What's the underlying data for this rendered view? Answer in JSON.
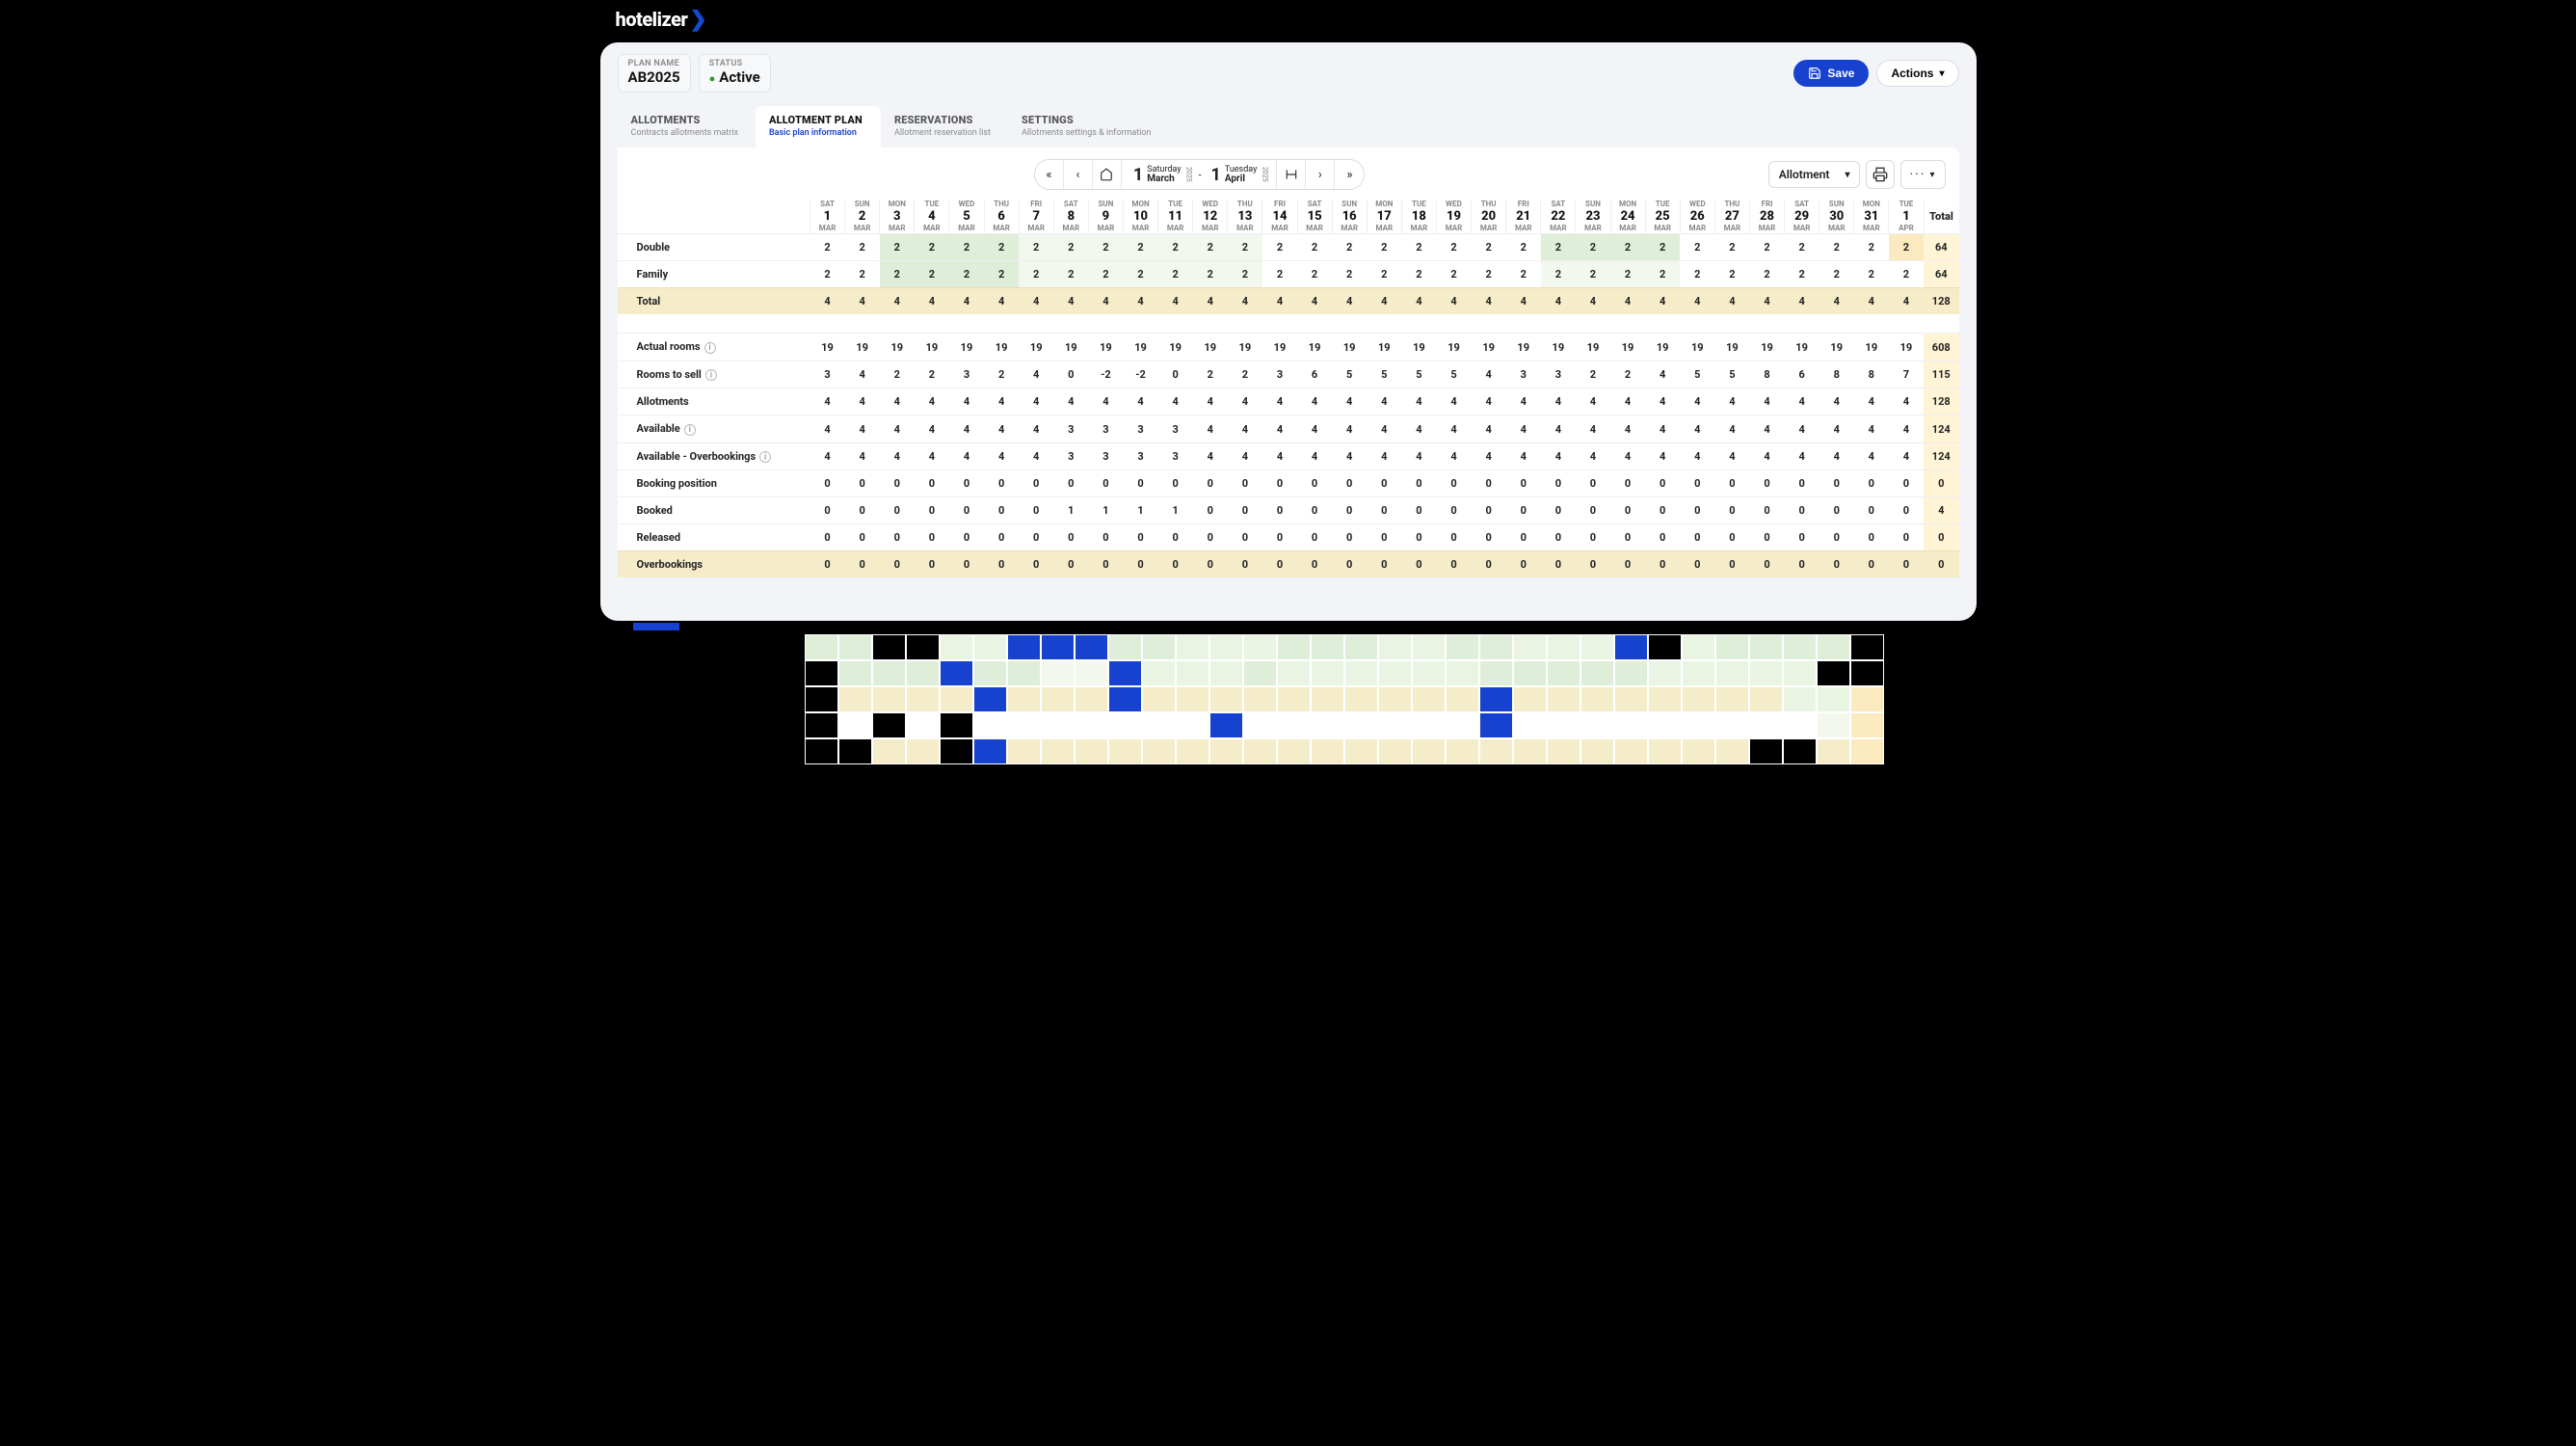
{
  "logo": {
    "text": "hotelizer"
  },
  "plan": {
    "name_label": "PLAN NAME",
    "name": "AB2025",
    "status_label": "STATUS",
    "status": "Active"
  },
  "actions": {
    "save": "Save",
    "more": "Actions"
  },
  "tabs": [
    {
      "title": "ALLOTMENTS",
      "sub": "Contracts allotments matrix"
    },
    {
      "title": "ALLOTMENT PLAN",
      "sub": "Basic plan information"
    },
    {
      "title": "RESERVATIONS",
      "sub": "Allotment reservation list"
    },
    {
      "title": "SETTINGS",
      "sub": "Allotments settings & information"
    }
  ],
  "daterange": {
    "from_day": "1",
    "from_dow": "Saturday",
    "from_month": "March",
    "from_year": "2025",
    "to_day": "1",
    "to_dow": "Tuesday",
    "to_month": "April",
    "to_year": "2025",
    "sep": "-"
  },
  "view_select": "Allotment",
  "columns": [
    {
      "dow": "SAT",
      "d": "1",
      "m": "MAR"
    },
    {
      "dow": "SUN",
      "d": "2",
      "m": "MAR"
    },
    {
      "dow": "MON",
      "d": "3",
      "m": "MAR"
    },
    {
      "dow": "TUE",
      "d": "4",
      "m": "MAR"
    },
    {
      "dow": "WED",
      "d": "5",
      "m": "MAR"
    },
    {
      "dow": "THU",
      "d": "6",
      "m": "MAR"
    },
    {
      "dow": "FRI",
      "d": "7",
      "m": "MAR"
    },
    {
      "dow": "SAT",
      "d": "8",
      "m": "MAR"
    },
    {
      "dow": "SUN",
      "d": "9",
      "m": "MAR"
    },
    {
      "dow": "MON",
      "d": "10",
      "m": "MAR"
    },
    {
      "dow": "TUE",
      "d": "11",
      "m": "MAR"
    },
    {
      "dow": "WED",
      "d": "12",
      "m": "MAR"
    },
    {
      "dow": "THU",
      "d": "13",
      "m": "MAR"
    },
    {
      "dow": "FRI",
      "d": "14",
      "m": "MAR"
    },
    {
      "dow": "SAT",
      "d": "15",
      "m": "MAR"
    },
    {
      "dow": "SUN",
      "d": "16",
      "m": "MAR"
    },
    {
      "dow": "MON",
      "d": "17",
      "m": "MAR"
    },
    {
      "dow": "TUE",
      "d": "18",
      "m": "MAR"
    },
    {
      "dow": "WED",
      "d": "19",
      "m": "MAR"
    },
    {
      "dow": "THU",
      "d": "20",
      "m": "MAR"
    },
    {
      "dow": "FRI",
      "d": "21",
      "m": "MAR"
    },
    {
      "dow": "SAT",
      "d": "22",
      "m": "MAR"
    },
    {
      "dow": "SUN",
      "d": "23",
      "m": "MAR"
    },
    {
      "dow": "MON",
      "d": "24",
      "m": "MAR"
    },
    {
      "dow": "TUE",
      "d": "25",
      "m": "MAR"
    },
    {
      "dow": "WED",
      "d": "26",
      "m": "MAR"
    },
    {
      "dow": "THU",
      "d": "27",
      "m": "MAR"
    },
    {
      "dow": "FRI",
      "d": "28",
      "m": "MAR"
    },
    {
      "dow": "SAT",
      "d": "29",
      "m": "MAR"
    },
    {
      "dow": "SUN",
      "d": "30",
      "m": "MAR"
    },
    {
      "dow": "MON",
      "d": "31",
      "m": "MAR"
    },
    {
      "dow": "TUE",
      "d": "1",
      "m": "APR"
    }
  ],
  "total_header": "Total",
  "section1": [
    {
      "label": "Double",
      "values": [
        2,
        2,
        2,
        2,
        2,
        2,
        2,
        2,
        2,
        2,
        2,
        2,
        2,
        2,
        2,
        2,
        2,
        2,
        2,
        2,
        2,
        2,
        2,
        2,
        2,
        2,
        2,
        2,
        2,
        2,
        2,
        2
      ],
      "total": 64,
      "shade": [
        "",
        "",
        "g1",
        "g1",
        "g1",
        "g1",
        "g3",
        "g3",
        "g3",
        "g3",
        "g3",
        "g3",
        "g3",
        "",
        "",
        "",
        "",
        "",
        "",
        "",
        "",
        "g1",
        "g1",
        "g1",
        "g1",
        "",
        "",
        "",
        "",
        "",
        "",
        "y"
      ]
    },
    {
      "label": "Family",
      "values": [
        2,
        2,
        2,
        2,
        2,
        2,
        2,
        2,
        2,
        2,
        2,
        2,
        2,
        2,
        2,
        2,
        2,
        2,
        2,
        2,
        2,
        2,
        2,
        2,
        2,
        2,
        2,
        2,
        2,
        2,
        2,
        2
      ],
      "total": 64,
      "shade": [
        "",
        "",
        "g1",
        "g1",
        "g1",
        "g1",
        "g3",
        "g3",
        "g3",
        "g3",
        "g3",
        "g3",
        "g3",
        "",
        "",
        "",
        "",
        "",
        "",
        "",
        "",
        "g3",
        "g3",
        "g3",
        "g3",
        "",
        "",
        "",
        "",
        "",
        "",
        "",
        ""
      ]
    }
  ],
  "section1_total": {
    "label": "Total",
    "values": [
      4,
      4,
      4,
      4,
      4,
      4,
      4,
      4,
      4,
      4,
      4,
      4,
      4,
      4,
      4,
      4,
      4,
      4,
      4,
      4,
      4,
      4,
      4,
      4,
      4,
      4,
      4,
      4,
      4,
      4,
      4,
      4
    ],
    "total": 128
  },
  "section2": [
    {
      "label": "Actual rooms",
      "info": true,
      "values": [
        19,
        19,
        19,
        19,
        19,
        19,
        19,
        19,
        19,
        19,
        19,
        19,
        19,
        19,
        19,
        19,
        19,
        19,
        19,
        19,
        19,
        19,
        19,
        19,
        19,
        19,
        19,
        19,
        19,
        19,
        19,
        19
      ],
      "total": 608
    },
    {
      "label": "Rooms to sell",
      "info": true,
      "values": [
        3,
        4,
        2,
        2,
        3,
        2,
        4,
        0,
        -2,
        -2,
        0,
        2,
        2,
        3,
        6,
        5,
        5,
        5,
        5,
        4,
        3,
        3,
        2,
        2,
        4,
        5,
        5,
        8,
        6,
        8,
        8,
        7
      ],
      "total": 115
    },
    {
      "label": "Allotments",
      "values": [
        4,
        4,
        4,
        4,
        4,
        4,
        4,
        4,
        4,
        4,
        4,
        4,
        4,
        4,
        4,
        4,
        4,
        4,
        4,
        4,
        4,
        4,
        4,
        4,
        4,
        4,
        4,
        4,
        4,
        4,
        4,
        4
      ],
      "total": 128
    },
    {
      "label": "Available",
      "info": true,
      "values": [
        4,
        4,
        4,
        4,
        4,
        4,
        4,
        3,
        3,
        3,
        3,
        4,
        4,
        4,
        4,
        4,
        4,
        4,
        4,
        4,
        4,
        4,
        4,
        4,
        4,
        4,
        4,
        4,
        4,
        4,
        4,
        4
      ],
      "total": 124
    },
    {
      "label": "Available - Overbookings",
      "info": true,
      "values": [
        4,
        4,
        4,
        4,
        4,
        4,
        4,
        3,
        3,
        3,
        3,
        4,
        4,
        4,
        4,
        4,
        4,
        4,
        4,
        4,
        4,
        4,
        4,
        4,
        4,
        4,
        4,
        4,
        4,
        4,
        4,
        4
      ],
      "total": 124
    },
    {
      "label": "Booking position",
      "values": [
        0,
        0,
        0,
        0,
        0,
        0,
        0,
        0,
        0,
        0,
        0,
        0,
        0,
        0,
        0,
        0,
        0,
        0,
        0,
        0,
        0,
        0,
        0,
        0,
        0,
        0,
        0,
        0,
        0,
        0,
        0,
        0
      ],
      "total": 0
    },
    {
      "label": "Booked",
      "values": [
        0,
        0,
        0,
        0,
        0,
        0,
        0,
        1,
        1,
        1,
        1,
        0,
        0,
        0,
        0,
        0,
        0,
        0,
        0,
        0,
        0,
        0,
        0,
        0,
        0,
        0,
        0,
        0,
        0,
        0,
        0,
        0
      ],
      "total": 4
    },
    {
      "label": "Released",
      "values": [
        0,
        0,
        0,
        0,
        0,
        0,
        0,
        0,
        0,
        0,
        0,
        0,
        0,
        0,
        0,
        0,
        0,
        0,
        0,
        0,
        0,
        0,
        0,
        0,
        0,
        0,
        0,
        0,
        0,
        0,
        0,
        0
      ],
      "total": 0
    }
  ],
  "section2_total": {
    "label": "Overbookings",
    "values": [
      0,
      0,
      0,
      0,
      0,
      0,
      0,
      0,
      0,
      0,
      0,
      0,
      0,
      0,
      0,
      0,
      0,
      0,
      0,
      0,
      0,
      0,
      0,
      0,
      0,
      0,
      0,
      0,
      0,
      0,
      0,
      0
    ],
    "total": 0
  }
}
